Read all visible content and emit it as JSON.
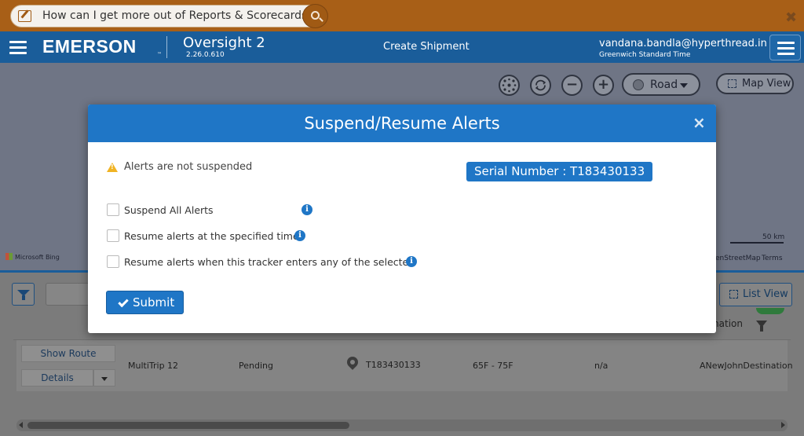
{
  "help_bar": {
    "question": "How can I get more out of Reports & Scorecards?",
    "close": "✖"
  },
  "header": {
    "logo": "EMERSON",
    "logo_tm": "™",
    "app_title": "Oversight 2",
    "version": "2.26.0.610",
    "page_title": "Create Shipment",
    "user_email": "vandana.bandla@hyperthread.in",
    "timezone": "Greenwich Standard Time"
  },
  "map": {
    "zoom_out": "−",
    "zoom_in": "+",
    "map_type": "Road",
    "view_toggle": "Map View",
    "bing_attribution": "Microsoft Bing",
    "scale": "50 km",
    "osm_attribution": "enStreetMap",
    "terms": "Terms"
  },
  "list": {
    "list_view_label": "List View",
    "destination_header": "tination",
    "row": {
      "show_route": "Show Route",
      "details": "Details",
      "trip_name": "MultiTrip 12",
      "status": "Pending",
      "tracker": "T183430133",
      "temp_range": "65F - 75F",
      "extra": "n/a",
      "destination": "ANewJohnDestination"
    }
  },
  "modal": {
    "title": "Suspend/Resume Alerts",
    "close": "×",
    "status_text": "Alerts are not suspended",
    "serial_number": "Serial Number : T183430133",
    "options": [
      {
        "label": "Suspend All Alerts",
        "checked": false
      },
      {
        "label": "Resume alerts at the specified time",
        "checked": false
      },
      {
        "label": "Resume alerts when this tracker enters any of the selected",
        "checked": false
      }
    ],
    "info": "i",
    "submit_label": "Submit"
  },
  "colors": {
    "brand_blue": "#1a5d9a",
    "modal_blue": "#1f76c6",
    "help_orange": "#a85f17",
    "warning": "#f0b323"
  }
}
